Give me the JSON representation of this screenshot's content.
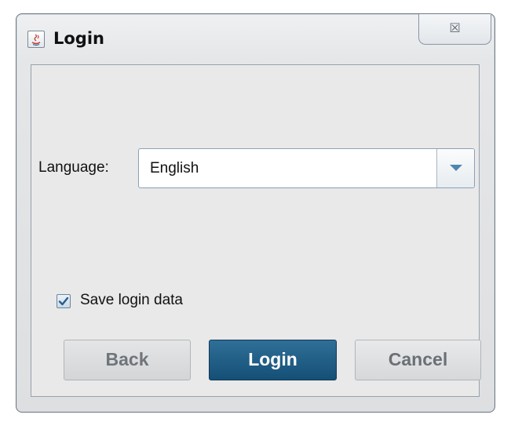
{
  "window": {
    "title": "Login",
    "close_symbol": "☒"
  },
  "form": {
    "language_label": "Language:",
    "language_value": "English",
    "save_login_label": "Save login data",
    "save_login_checked": true
  },
  "buttons": {
    "back_label": "Back",
    "login_label": "Login",
    "cancel_label": "Cancel"
  },
  "icons": {
    "app": "java-app-icon",
    "close": "close-icon",
    "dropdown": "chevron-down-icon",
    "check": "checkmark-icon"
  },
  "colors": {
    "primary_button": "#1b5a82",
    "accent_blue": "#4f86b0"
  }
}
